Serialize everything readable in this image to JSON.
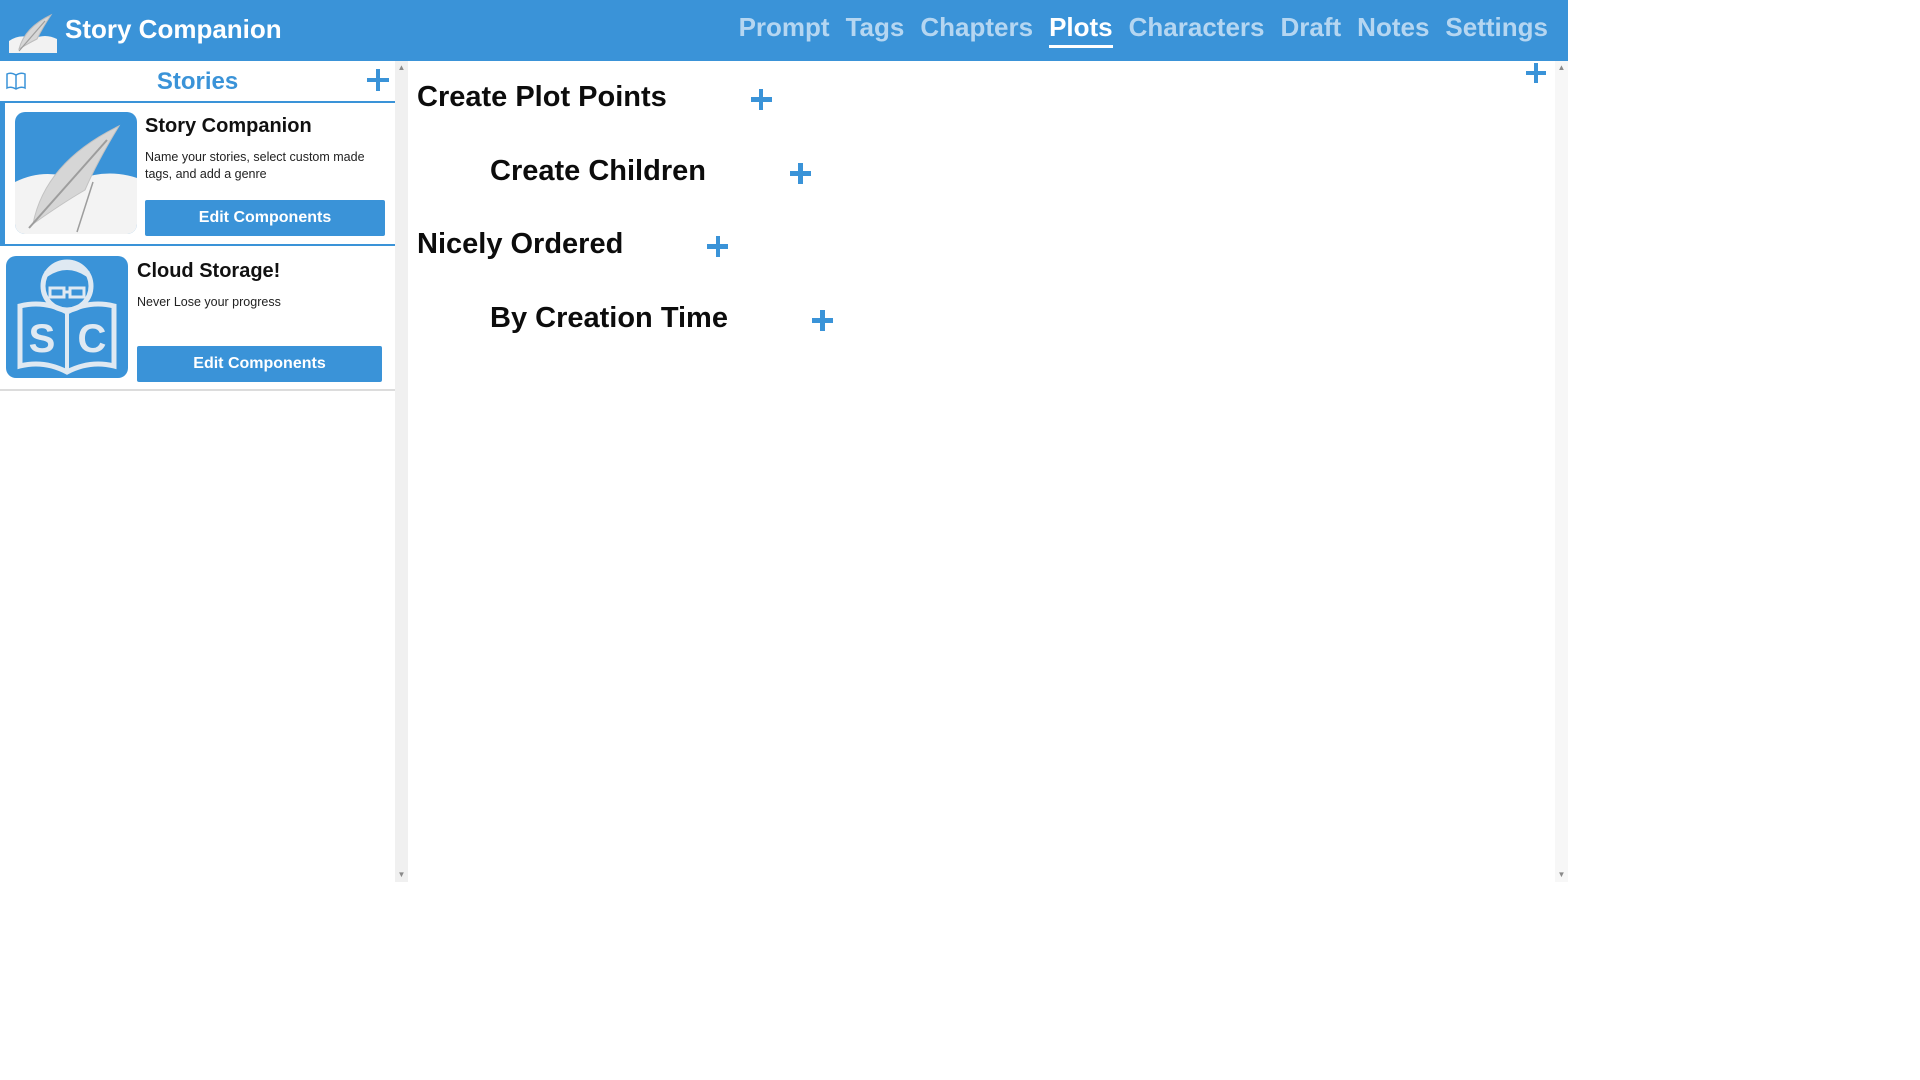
{
  "app": {
    "title": "Story Companion",
    "accent_color": "#3a93d8"
  },
  "nav": {
    "items": [
      {
        "label": "Prompt",
        "active": false
      },
      {
        "label": "Tags",
        "active": false
      },
      {
        "label": "Chapters",
        "active": false
      },
      {
        "label": "Plots",
        "active": true
      },
      {
        "label": "Characters",
        "active": false
      },
      {
        "label": "Draft",
        "active": false
      },
      {
        "label": "Notes",
        "active": false
      },
      {
        "label": "Settings",
        "active": false
      }
    ]
  },
  "sidebar": {
    "title": "Stories",
    "header_icon": "book-icon",
    "add_icon": "plus-icon",
    "stories": [
      {
        "title": "Story Companion",
        "description": "Name your stories, select custom made tags, and add a genre",
        "button_label": "Edit Components",
        "thumbnail_icon": "feather-icon",
        "selected": true
      },
      {
        "title": "Cloud Storage!",
        "description": "Never Lose your progress",
        "button_label": "Edit Components",
        "thumbnail_icon": "reader-sc-icon",
        "selected": false
      }
    ]
  },
  "main": {
    "add_icon": "plus-icon",
    "plot_points": [
      {
        "label": "Create Plot Points",
        "level": 0
      },
      {
        "label": "Create Children",
        "level": 1
      },
      {
        "label": "Nicely Ordered",
        "level": 0
      },
      {
        "label": "By Creation Time",
        "level": 1
      }
    ]
  }
}
